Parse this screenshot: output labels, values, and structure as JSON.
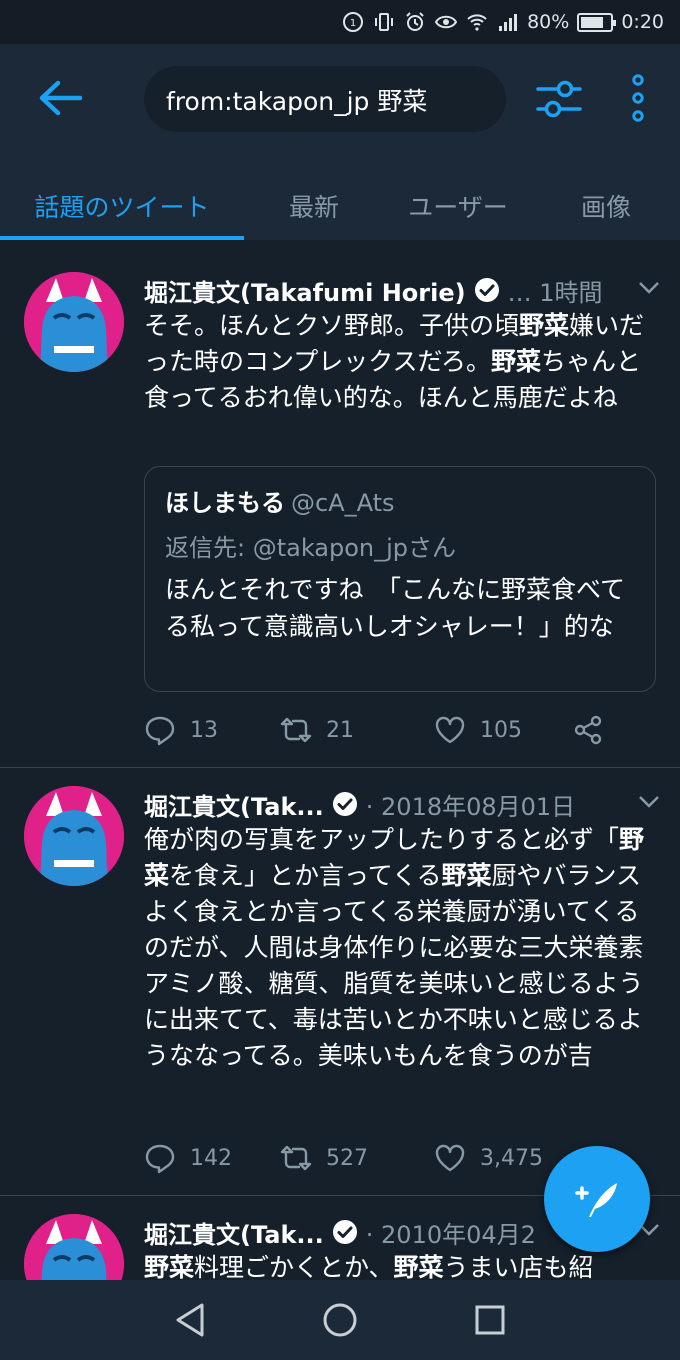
{
  "status_bar": {
    "battery": "80%",
    "time": "0:20",
    "battery_level": 0.8
  },
  "search": {
    "query": "from:takapon_jp 野菜"
  },
  "tabs": [
    {
      "label": "話題のツイート",
      "active": true
    },
    {
      "label": "最新",
      "active": false
    },
    {
      "label": "ユーザー",
      "active": false
    },
    {
      "label": "画像",
      "active": false
    }
  ],
  "tweets": [
    {
      "name": "堀江貴文(Takafumi Horie)",
      "meta": "… 1時間",
      "text_parts": [
        "そそ。ほんとクソ野郎。子供の頃",
        "野菜",
        "嫌いだった時のコンプレックスだろ。",
        "野菜",
        "ちゃんと食ってるおれ偉い的な。ほんと馬鹿だよね"
      ],
      "quote": {
        "name": "ほしまもる",
        "handle": "@cA_Ats",
        "reply_to": "返信先: @takapon_jpさん",
        "text": "ほんとそれですね　「こんなに野菜食べてる私って意識高いしオシャレー！」的な"
      },
      "replies": "13",
      "retweets": "21",
      "likes": "105"
    },
    {
      "name": "堀江貴文(Tak...",
      "meta": "· 2018年08月01日",
      "text_parts": [
        "俺が肉の写真をアップしたりすると必ず「",
        "野菜",
        "を食え」とか言ってくる",
        "野菜",
        "厨やバランスよく食えとか言ってくる栄養厨が湧いてくるのだが、人間は身体作りに必要な三大栄養素アミノ酸、糖質、脂質を美味いと感じるように出来てて、毒は苦いとか不味いと感じるようななってる。美味いもんを食うのが吉"
      ],
      "replies": "142",
      "retweets": "527",
      "likes": "3,475"
    },
    {
      "name": "堀江貴文(Tak...",
      "meta": "· 2010年04月2",
      "text_parts": [
        "野菜",
        "料理ごかくとか、",
        "野菜",
        "うまい店も紹"
      ]
    }
  ],
  "colors": {
    "accent": "#1da1f2",
    "bg": "#15202b",
    "header": "#1c2938",
    "muted": "#8899a6",
    "avatar": "#e0218a"
  }
}
